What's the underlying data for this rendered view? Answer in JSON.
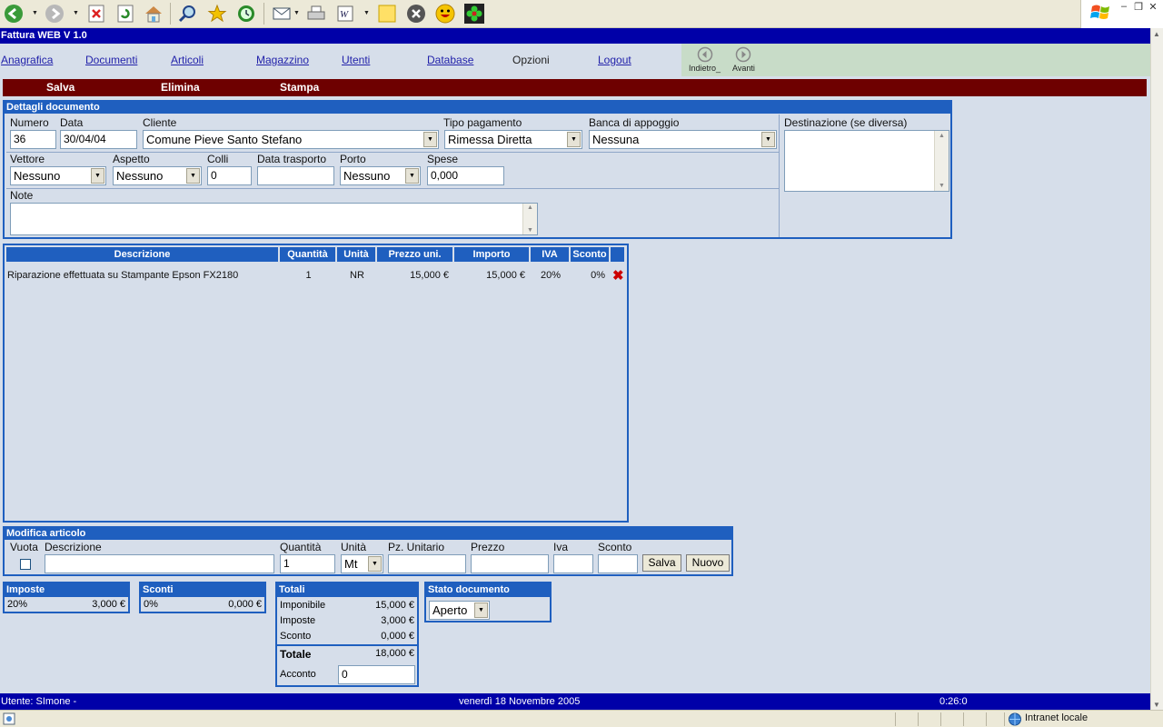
{
  "app": {
    "title": "Fattura WEB V 1.0"
  },
  "browser": {
    "toolbar_icons": [
      "back-icon",
      "forward-icon",
      "stop-icon",
      "refresh-icon",
      "home-icon",
      "search-icon",
      "favorites-icon",
      "history-icon",
      "mail-icon",
      "print-icon",
      "edit-icon",
      "note-icon",
      "close-icon",
      "smiley-icon",
      "flower-icon"
    ],
    "status_zone": "Intranet locale"
  },
  "nav": {
    "items": [
      "Anagrafica",
      "Documenti",
      "Articoli",
      "Magazzino",
      "Utenti",
      "Database",
      "Opzioni",
      "Logout"
    ],
    "back_label": "Indietro_",
    "forward_label": "Avanti"
  },
  "actions": {
    "save": "Salva",
    "delete": "Elimina",
    "print": "Stampa"
  },
  "document": {
    "header": "Dettagli documento",
    "numero_label": "Numero",
    "numero": "36",
    "data_label": "Data",
    "data": "30/04/04",
    "cliente_label": "Cliente",
    "cliente": "Comune Pieve Santo Stefano",
    "tipo_pagamento_label": "Tipo pagamento",
    "tipo_pagamento": "Rimessa Diretta",
    "banca_label": "Banca di appoggio",
    "banca": "Nessuna",
    "destinazione_label": "Destinazione (se diversa)",
    "vettore_label": "Vettore",
    "vettore": "Nessuno",
    "aspetto_label": "Aspetto",
    "aspetto": "Nessuno",
    "colli_label": "Colli",
    "colli": "0",
    "data_trasporto_label": "Data trasporto",
    "porto_label": "Porto",
    "porto": "Nessuno",
    "spese_label": "Spese",
    "spese": "0,000",
    "note_label": "Note"
  },
  "items_table": {
    "columns": [
      "Descrizione",
      "Quantità",
      "Unità",
      "Prezzo uni.",
      "Importo",
      "IVA",
      "Sconto"
    ],
    "rows": [
      {
        "descrizione": "Riparazione effettuata su Stampante Epson FX2180",
        "quantita": "1",
        "unita": "NR",
        "prezzo": "15,000 €",
        "importo": "15,000 €",
        "iva": "20%",
        "sconto": "0%"
      }
    ]
  },
  "modifica": {
    "header": "Modifica articolo",
    "vuota_label": "Vuota",
    "descrizione_label": "Descrizione",
    "quantita_label": "Quantità",
    "quantita": "1",
    "unita_label": "Unità",
    "unita": "Mt",
    "pz_unitario_label": "Pz. Unitario",
    "prezzo_label": "Prezzo",
    "iva_label": "Iva",
    "sconto_label": "Sconto",
    "save_button": "Salva",
    "new_button": "Nuovo"
  },
  "imposte": {
    "header": "Imposte",
    "rate": "20%",
    "value": "3,000 €"
  },
  "sconti": {
    "header": "Sconti",
    "rate": "0%",
    "value": "0,000 €"
  },
  "totali": {
    "header": "Totali",
    "imponibile_label": "Imponibile",
    "imponibile": "15,000 €",
    "imposte_label": "Imposte",
    "imposte": "3,000 €",
    "sconto_label": "Sconto",
    "sconto": "0,000 €",
    "totale_label": "Totale",
    "totale": "18,000 €",
    "acconto_label": "Acconto",
    "acconto": "0"
  },
  "stato": {
    "header": "Stato documento",
    "value": "Aperto"
  },
  "status": {
    "user": "Utente: SImone -",
    "date": "venerdì 18 Novembre 2005",
    "time": "0:26:0"
  }
}
